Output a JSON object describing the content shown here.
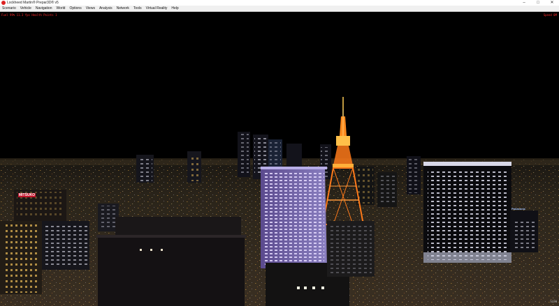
{
  "window": {
    "title": "Lockheed Martin® Prepar3D® v5",
    "minimize": "–",
    "maximize": "□",
    "close": "✕"
  },
  "menu": [
    "Scenario",
    "Vehicle",
    "Navigation",
    "World",
    "Options",
    "Views",
    "Analysis",
    "Network",
    "Tools",
    "Virtual Reality",
    "Help"
  ],
  "hud": {
    "left": "Fuel 99%   11.3 fps  Health Points  1",
    "right": "Speed 0M",
    "bottom": "SLEW"
  },
  "scene_labels": {
    "sign_mitsukoshi": "MITSUKO",
    "sign_panasonic": "Panasonic"
  },
  "colors": {
    "tower": "#ff7a1a",
    "tower_light": "#ffcc55",
    "sky": "#000000",
    "hud": "#ff2a2a"
  }
}
